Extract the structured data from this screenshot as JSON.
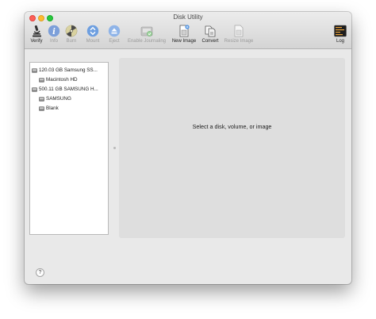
{
  "window": {
    "title": "Disk Utility"
  },
  "toolbar": {
    "items": [
      {
        "label": "Verify",
        "icon": "microscope-icon",
        "enabled": true
      },
      {
        "label": "Info",
        "icon": "info-icon",
        "enabled": false
      },
      {
        "label": "Burn",
        "icon": "radiation-burn-icon",
        "enabled": false
      },
      {
        "label": "Mount",
        "icon": "mount-icon",
        "enabled": false
      },
      {
        "label": "Eject",
        "icon": "eject-icon",
        "enabled": false
      },
      {
        "label": "Enable Journaling",
        "icon": "journal-disk-icon",
        "enabled": false
      },
      {
        "label": "New Image",
        "icon": "new-image-icon",
        "enabled": true
      },
      {
        "label": "Convert",
        "icon": "convert-icon",
        "enabled": true
      },
      {
        "label": "Resize Image",
        "icon": "resize-image-icon",
        "enabled": false
      }
    ],
    "log": {
      "label": "Log",
      "icon": "console-log-icon",
      "enabled": true
    }
  },
  "sidebar": {
    "items": [
      {
        "label": "120.03 GB Samsung SS...",
        "level": 0
      },
      {
        "label": "Macintosh HD",
        "level": 1
      },
      {
        "label": "500.11 GB SAMSUNG H...",
        "level": 0
      },
      {
        "label": "SAMSUNG",
        "level": 1
      },
      {
        "label": "Blank",
        "level": 1
      }
    ]
  },
  "main": {
    "message": "Select a disk, volume, or image"
  },
  "help": {
    "symbol": "?"
  },
  "colors": {
    "close": "#fc5f57",
    "minimize": "#fdbc2e",
    "maximize": "#28c83f",
    "toolbar_blue": "#4a90e2",
    "panel_bg": "#dedede"
  }
}
